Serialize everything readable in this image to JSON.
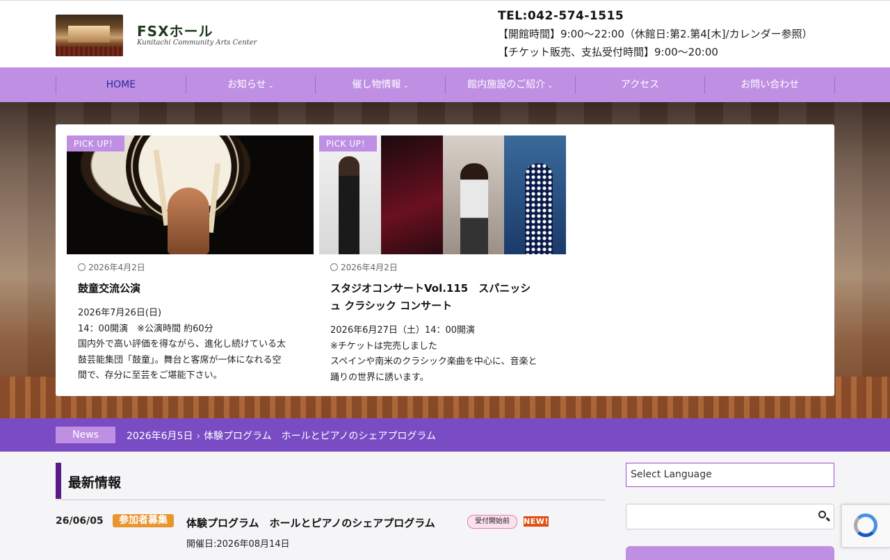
{
  "header": {
    "logo_title": "FSXホール",
    "logo_subtitle": "Kunitachi Community Arts Center",
    "tel": "TEL:042-574-1515",
    "hours": "【開館時間】9:00～22:00（休館日:第2.第4[木]/カレンダー参照）",
    "ticket_hours": "【チケット販売、支払受付時間】9:00～20:00"
  },
  "nav": {
    "items": [
      {
        "label": "HOME",
        "has_dropdown": false
      },
      {
        "label": "お知らせ",
        "has_dropdown": true
      },
      {
        "label": "催し物情報",
        "has_dropdown": true
      },
      {
        "label": "館内施設のご紹介",
        "has_dropdown": true
      },
      {
        "label": "アクセス",
        "has_dropdown": false
      },
      {
        "label": "お問い合わせ",
        "has_dropdown": false
      }
    ],
    "chevron": "⌄"
  },
  "pickups": [
    {
      "badge": "PICK UP！",
      "date": "2026年4月2日",
      "title": "鼓童交流公演",
      "lines": [
        "2026年7月26日(日)",
        "14：00開演　※公演時間 約60分",
        "国内外で高い評価を得ながら、進化し続けている太",
        "鼓芸能集団「鼓童」。舞台と客席が一体になれる空",
        "間で、存分に至芸をご堪能下さい。"
      ]
    },
    {
      "badge": "PICK UP！",
      "date": "2026年4月2日",
      "title_lines": [
        "スタジオコンサートVol.115　スパニッシ",
        "ュ クラシック コンサート"
      ],
      "lines": [
        "2026年6月27日（土）14：00開演",
        "※チケットは完売しました",
        "スペインや南米のクラシック楽曲を中心に、音楽と",
        "踊りの世界に誘います。"
      ]
    }
  ],
  "news_ticker": {
    "label": "News",
    "date": "2026年6月5日",
    "separator": "›",
    "text": "体験プログラム　ホールとピアノのシェアプログラム"
  },
  "latest": {
    "heading": "最新情報",
    "items": [
      {
        "date": "26/06/05",
        "category": "参加者募集",
        "title": "体験プログラム　ホールとピアノのシェアプログラム",
        "status_badge": "受付開始前",
        "new_badge": "NEW!",
        "sub": "開催日:2026年08月14日"
      }
    ]
  },
  "sidebar": {
    "language_placeholder": "Select Language",
    "search_value": ""
  },
  "icons": {
    "search": "search-icon",
    "clock": "clock-icon",
    "recaptcha": "recaptcha-icon"
  },
  "colors": {
    "nav": "#bf8fe3",
    "news_bar": "#7a4cc4",
    "heading_bar": "#5a1a8a",
    "category": "#e8952e",
    "new_badge": "#e05010"
  }
}
